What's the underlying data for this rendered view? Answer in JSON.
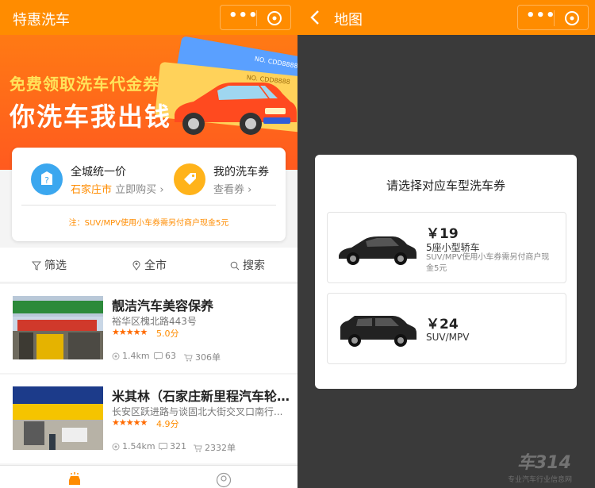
{
  "left": {
    "header": {
      "title": "特惠洗车"
    },
    "banner": {
      "line1": "免费领取洗车代金券",
      "line2": "你洗车我出钱",
      "ticket_no_1": "NO. CDD8888",
      "ticket_no_2": "NO. CDD8888"
    },
    "card": {
      "feature1": {
        "title": "全城统一价",
        "city": "石家庄市",
        "action": "立即购买",
        "arrow": "›"
      },
      "feature2": {
        "title": "我的洗车券",
        "action": "查看券",
        "arrow": "›"
      },
      "note": "注：SUV/MPV使用小车券需另付商户现金5元"
    },
    "filters": [
      {
        "label": "筛选"
      },
      {
        "label": "全市"
      },
      {
        "label": "搜索"
      }
    ],
    "shops": [
      {
        "name": "靓洁汽车美容保养",
        "address": "裕华区槐北路443号",
        "stars": "★★★★★",
        "rating": "5.0分",
        "distance": "1.4km",
        "comments": "63",
        "orders": "306单"
      },
      {
        "name": "米其林（石家庄新里程汽车轮胎...",
        "address": "长安区跃进路与谈固北大街交叉口南行...",
        "stars": "★★★★★",
        "rating": "4.9分",
        "distance": "1.54km",
        "comments": "321",
        "orders": "2332单"
      }
    ]
  },
  "right": {
    "header": {
      "title": "地图"
    },
    "modal": {
      "title": "请选择对应车型洗车券",
      "options": [
        {
          "price": "￥19",
          "label": "5座小型轿车",
          "desc": "SUV/MPV使用小车券需另付商户现金5元"
        },
        {
          "price": "￥24",
          "label": "SUV/MPV"
        }
      ]
    },
    "watermark": {
      "logo": "车314",
      "tagline": "专业汽车行业信息网"
    }
  },
  "colors": {
    "accent": "#ff8c00",
    "banner": "#ff5a1f",
    "overlay": "#3a3a3a"
  }
}
